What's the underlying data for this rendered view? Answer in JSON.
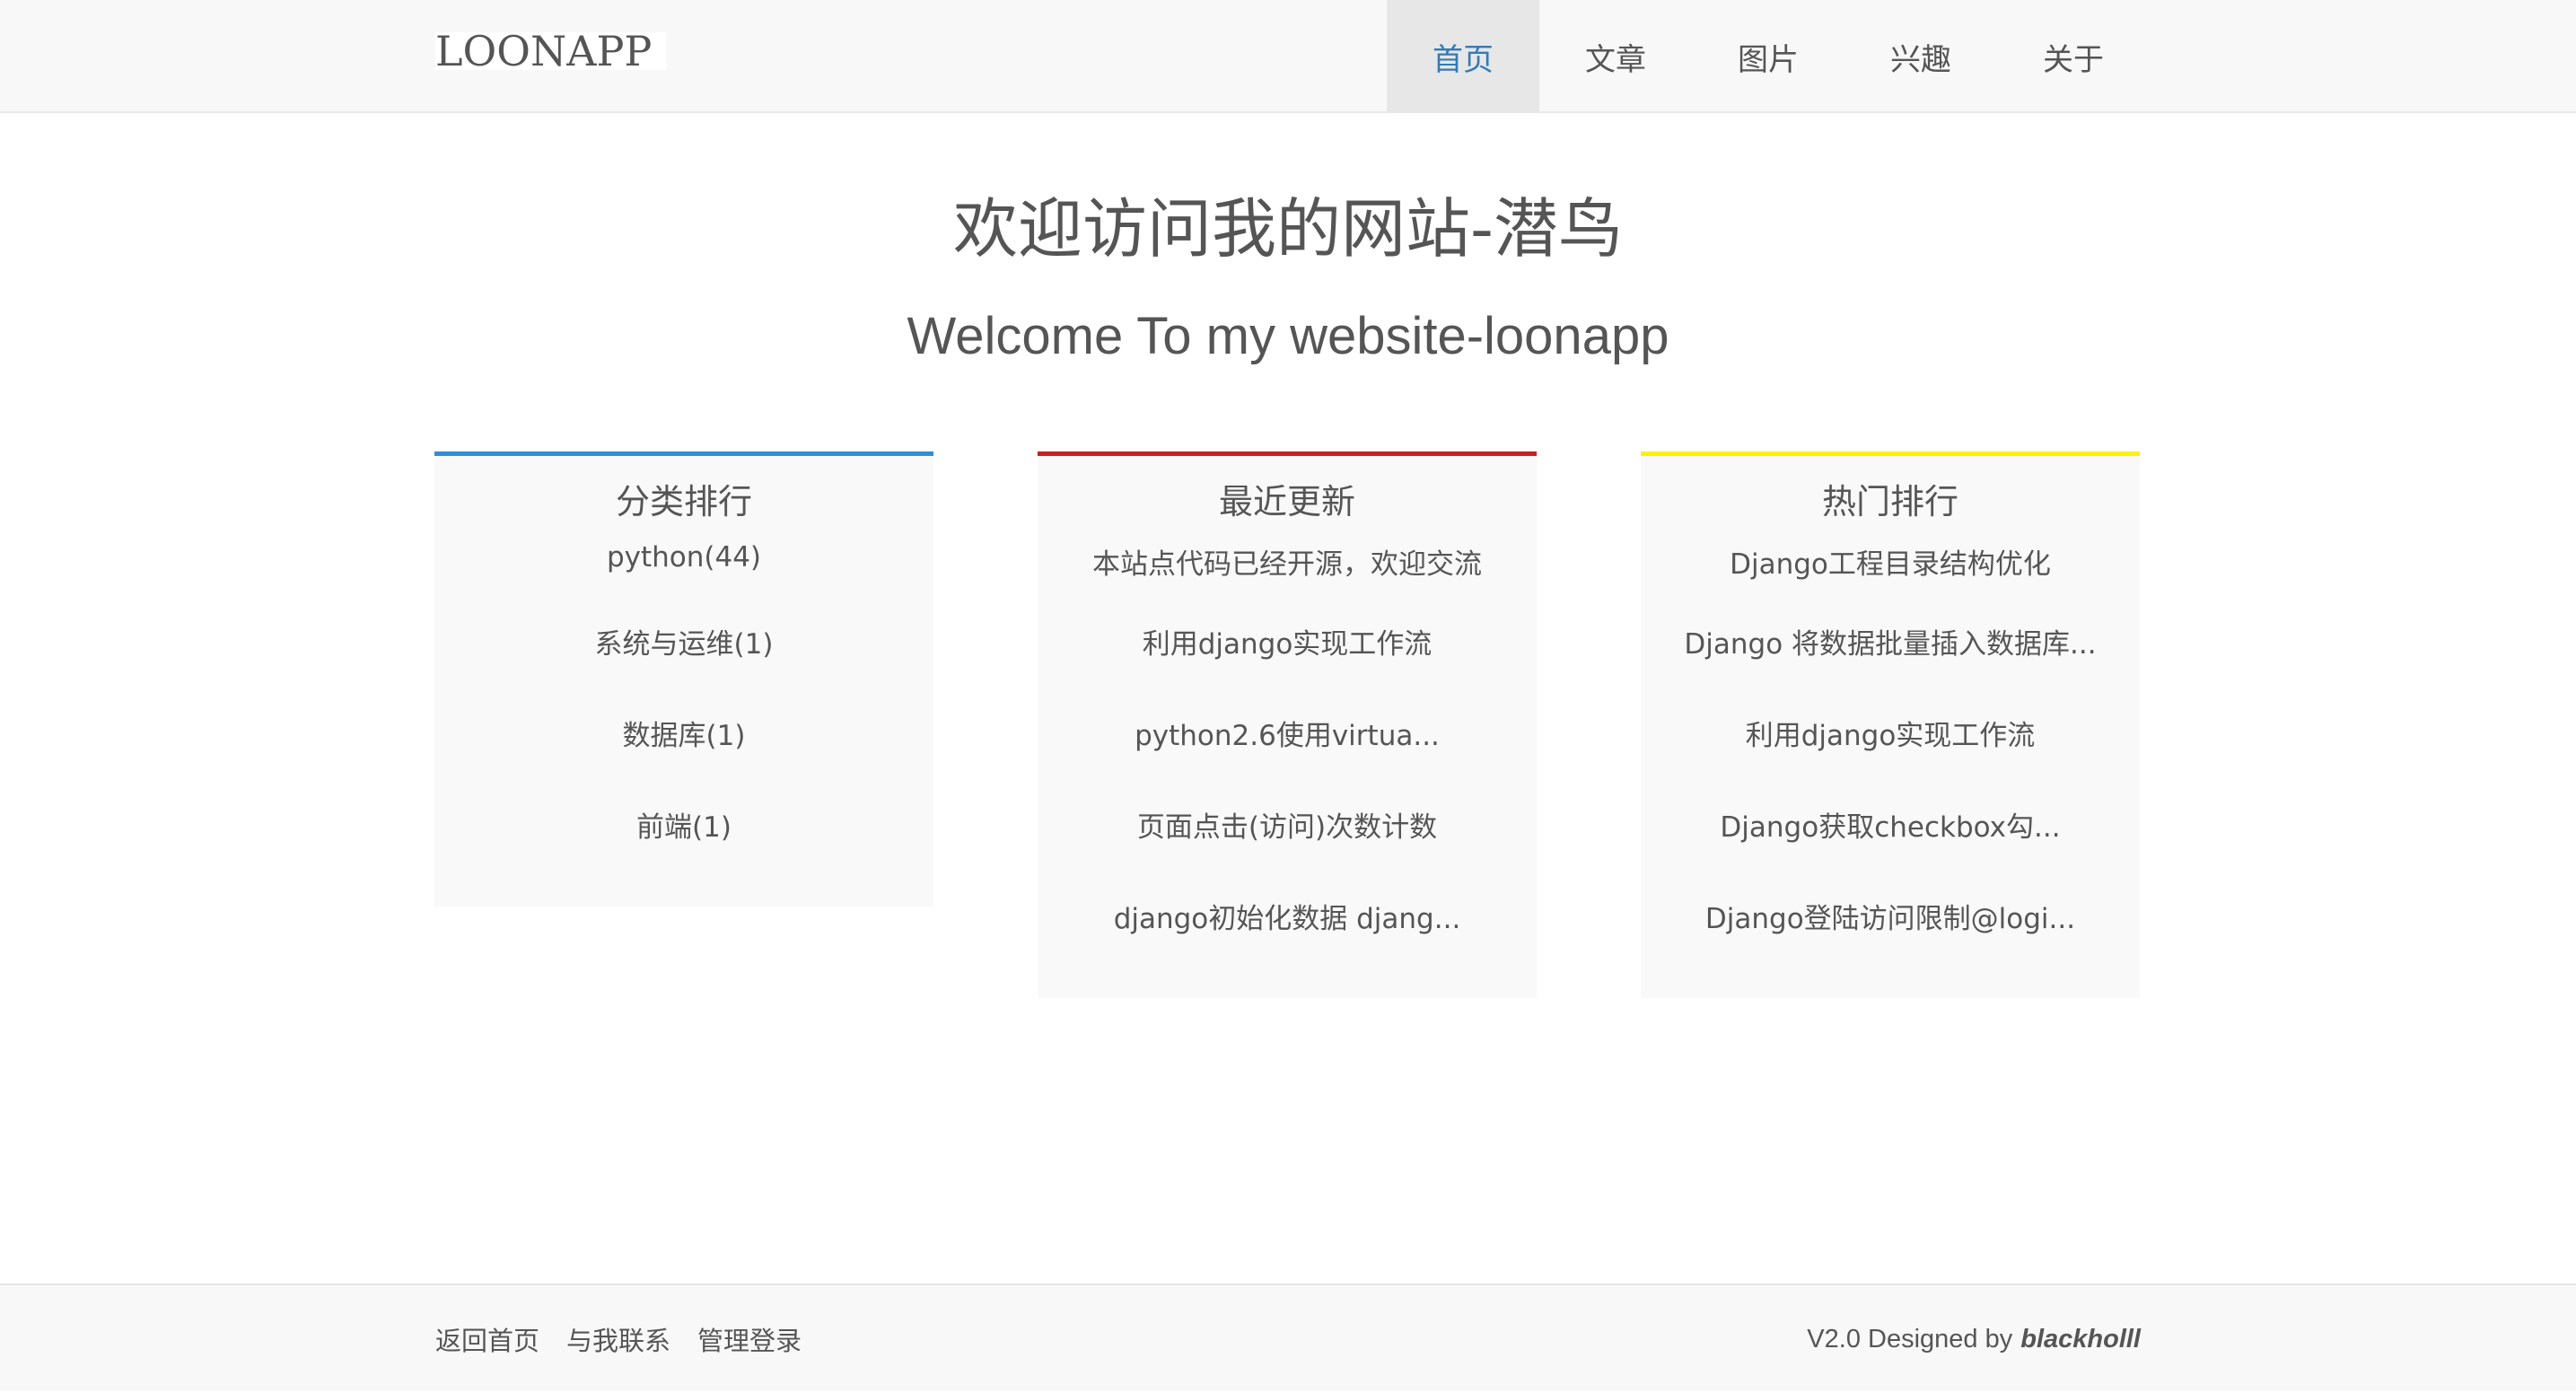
{
  "header": {
    "brand": "LOONAPP",
    "nav": [
      {
        "label": "首页",
        "active": true
      },
      {
        "label": "文章",
        "active": false
      },
      {
        "label": "图片",
        "active": false
      },
      {
        "label": "兴趣",
        "active": false
      },
      {
        "label": "关于",
        "active": false
      }
    ],
    "active_color": "#337ab7"
  },
  "hero": {
    "title": "欢迎访问我的网站-潜鸟",
    "subtitle": "Welcome To my website-loonapp"
  },
  "panels": {
    "categories": {
      "title": "分类排行",
      "accent": "#2e8fd8",
      "items": [
        "python(44)",
        "系统与运维(1)",
        "数据库(1)",
        "前端(1)"
      ]
    },
    "recent": {
      "title": "最近更新",
      "accent": "#cc1f1f",
      "items": [
        "本站点代码已经开源，欢迎交流",
        "利用django实现工作流",
        "python2.6使用virtua...",
        "页面点击(访问)次数计数",
        "django初始化数据 djang..."
      ]
    },
    "hot": {
      "title": "热门排行",
      "accent": "#fff200",
      "items": [
        "Django工程目录结构优化",
        "Django 将数据批量插入数据库...",
        "利用django实现工作流",
        "Django获取checkbox勾...",
        "Django登陆访问限制@logi..."
      ]
    }
  },
  "footer": {
    "links": [
      "返回首页",
      "与我联系",
      "管理登录"
    ],
    "credit_prefix": "V2.0 Designed by",
    "credit_author": "blackholll"
  }
}
